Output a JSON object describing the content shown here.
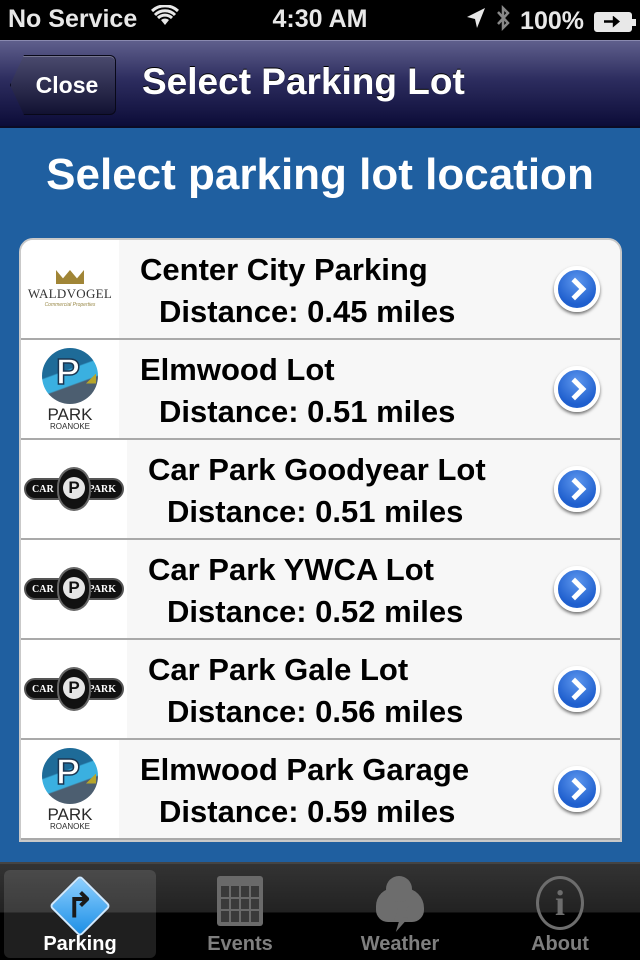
{
  "status_bar": {
    "carrier": "No Service",
    "time": "4:30 AM",
    "battery": "100%"
  },
  "nav": {
    "back_label": "Close",
    "title": "Select Parking Lot"
  },
  "heading": "Select parking lot location",
  "lots": [
    {
      "name": "Center City Parking",
      "distance": "Distance: 0.45 miles",
      "logo": "waldvogel",
      "logo_text": "WALDVOGEL",
      "logo_sub": "Commercial Properties"
    },
    {
      "name": "Elmwood Lot",
      "distance": "Distance: 0.51 miles",
      "logo": "park-roanoke",
      "logo_text": "PARK",
      "logo_sub": "ROANOKE"
    },
    {
      "name": "Car Park Goodyear Lot",
      "distance": "Distance: 0.51 miles",
      "logo": "the-car-park",
      "logo_text": "CAR",
      "logo_sub": "PARK"
    },
    {
      "name": "Car Park YWCA Lot",
      "distance": "Distance: 0.52 miles",
      "logo": "the-car-park",
      "logo_text": "CAR",
      "logo_sub": "PARK"
    },
    {
      "name": "Car Park Gale Lot",
      "distance": "Distance: 0.56 miles",
      "logo": "the-car-park",
      "logo_text": "CAR",
      "logo_sub": "PARK"
    },
    {
      "name": "Elmwood Park Garage",
      "distance": "Distance: 0.59 miles",
      "logo": "park-roanoke",
      "logo_text": "PARK",
      "logo_sub": "ROANOKE"
    }
  ],
  "tabs": [
    {
      "label": "Parking",
      "icon": "route-sign-icon",
      "active": true
    },
    {
      "label": "Events",
      "icon": "calendar-icon",
      "active": false
    },
    {
      "label": "Weather",
      "icon": "storm-cloud-icon",
      "active": false
    },
    {
      "label": "About",
      "icon": "info-icon",
      "active": false
    }
  ],
  "colors": {
    "background": "#1f5fa0",
    "accent": "#1f5fce",
    "nav_bar": "#2d2d5f"
  }
}
